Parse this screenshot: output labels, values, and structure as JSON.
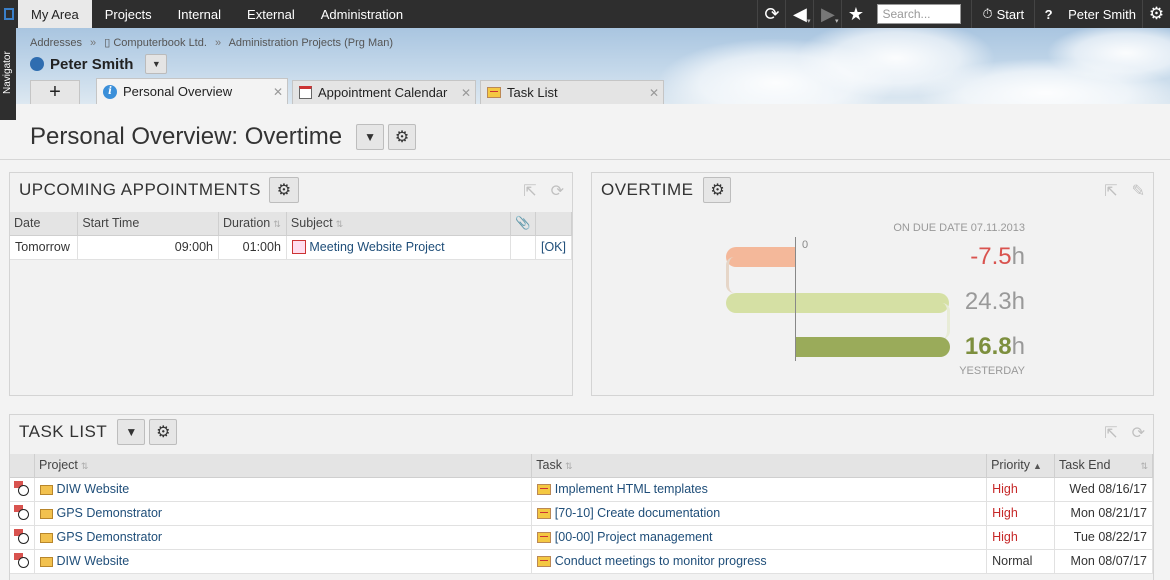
{
  "topnav": {
    "tabs": [
      "My Area",
      "Projects",
      "Internal",
      "External",
      "Administration"
    ],
    "search_placeholder": "Search...",
    "start_label": "Start",
    "help_label": "?",
    "user": "Peter Smith"
  },
  "navigator": {
    "label": "Navigator"
  },
  "header": {
    "breadcrumb": [
      "Addresses",
      "Computerbook Ltd.",
      "Administration Projects (Prg Man)"
    ],
    "person": "Peter Smith",
    "tabs": [
      {
        "label": "Personal Overview",
        "icon": "info-icon"
      },
      {
        "label": "Appointment Calendar",
        "icon": "calendar-icon"
      },
      {
        "label": "Task List",
        "icon": "task-icon"
      }
    ]
  },
  "page": {
    "title": "Personal Overview: Overtime"
  },
  "appointments": {
    "title": "UPCOMING APPOINTMENTS",
    "columns": [
      "Date",
      "Start Time",
      "Duration",
      "Subject"
    ],
    "rows": [
      {
        "date": "Tomorrow",
        "start": "09:00h",
        "duration": "01:00h",
        "subject": "Meeting Website Project",
        "status": "[OK]"
      }
    ]
  },
  "overtime": {
    "title": "OVERTIME",
    "due_label": "ON DUE DATE 07.11.2013",
    "zero_label": "0",
    "yesterday_label": "YESTERDAY",
    "values": [
      {
        "value": "-7.5",
        "unit": "h",
        "color": "#d9534f"
      },
      {
        "value": "24.3",
        "unit": "h",
        "color": "#999999"
      },
      {
        "value": "16.8",
        "unit": "h",
        "color": "#7d8f3e"
      }
    ],
    "bar_colors": [
      "#f4b89a",
      "#d5e0a4",
      "#9aab5a"
    ]
  },
  "tasks": {
    "title": "TASK LIST",
    "columns": [
      "Project",
      "Task",
      "Priority",
      "Task End"
    ],
    "rows": [
      {
        "project": "DIW Website",
        "task": "Implement HTML templates",
        "priority": "High",
        "end": "Wed 08/16/17"
      },
      {
        "project": "GPS Demonstrator",
        "task": "[70-10] Create documentation",
        "priority": "High",
        "end": "Mon 08/21/17"
      },
      {
        "project": "GPS Demonstrator",
        "task": "[00-00] Project management",
        "priority": "High",
        "end": "Tue 08/22/17"
      },
      {
        "project": "DIW Website",
        "task": "Conduct meetings to monitor progress",
        "priority": "Normal",
        "end": "Mon 08/07/17"
      }
    ]
  }
}
